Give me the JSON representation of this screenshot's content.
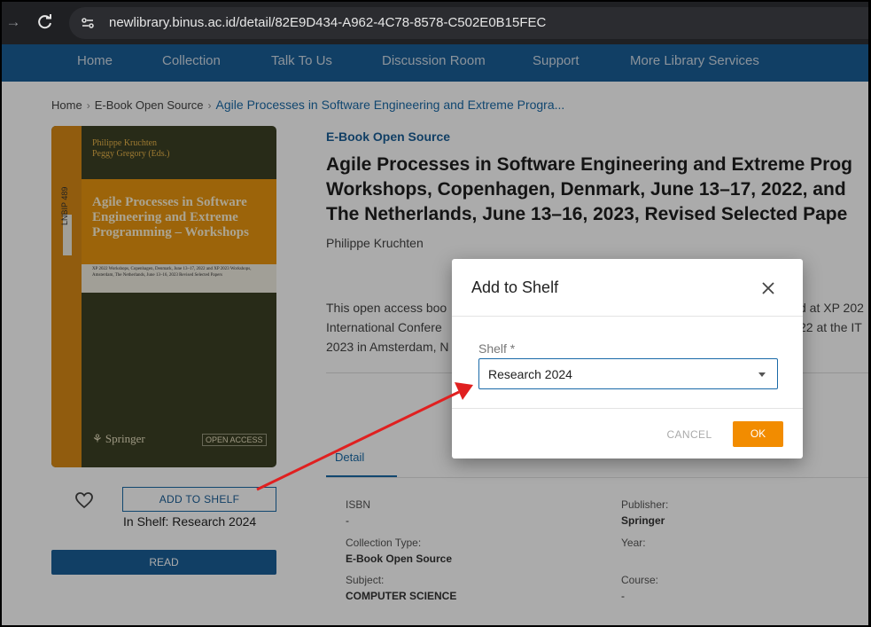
{
  "browser": {
    "url": "newlibrary.binus.ac.id/detail/82E9D434-A962-4C78-8578-C502E0B15FEC"
  },
  "nav": {
    "items": [
      "Home",
      "Collection",
      "Talk To Us",
      "Discussion Room",
      "Support",
      "More Library Services"
    ]
  },
  "breadcrumb": {
    "home": "Home",
    "category": "E-Book Open Source",
    "current": "Agile Processes in Software Engineering and Extreme Progra..."
  },
  "cover": {
    "authors": [
      "Philippe Kruchten",
      "Peggy Gregory (Eds.)"
    ],
    "series": "LNBIP 489",
    "title": "Agile Processes in Software Engineering and Extreme Programming – Workshops",
    "subtitle": "XP 2022 Workshops, Copenhagen, Denmark, June 13–17, 2022 and XP 2023 Workshops, Amsterdam, The Netherlands, June 13–16, 2023 Revised Selected Papers",
    "publisher": "Springer",
    "badge": "OPEN ACCESS"
  },
  "actions": {
    "add_to_shelf": "ADD TO SHELF",
    "in_shelf": "In Shelf: Research 2024",
    "read": "READ"
  },
  "book": {
    "type_label": "E-Book Open Source",
    "title_lines": [
      "Agile Processes in Software Engineering and Extreme Prog",
      "Workshops, Copenhagen, Denmark, June 13–17, 2022, and",
      "The Netherlands, June 13–16, 2023, Revised Selected Pape"
    ],
    "author": "Philippe Kruchten",
    "description_left": [
      "This open access boo",
      "International Confere",
      "2023 in Amsterdam, N"
    ],
    "description_right": [
      "d at XP 202",
      "22 at the IT",
      ""
    ]
  },
  "tabs": {
    "detail": "Detail"
  },
  "meta": {
    "isbn_label": "ISBN",
    "isbn_value": "-",
    "publisher_label": "Publisher:",
    "publisher_value": "Springer",
    "collection_label": "Collection Type:",
    "collection_value": "E-Book Open Source",
    "year_label": "Year:",
    "year_value": "",
    "subject_label": "Subject:",
    "subject_value": "COMPUTER SCIENCE",
    "course_label": "Course:",
    "course_value": "-"
  },
  "dialog": {
    "title": "Add to Shelf",
    "field_label": "Shelf *",
    "selected": "Research 2024",
    "cancel": "CANCEL",
    "ok": "OK"
  },
  "colors": {
    "brand_blue": "#1a5e97",
    "accent_orange": "#f28c00",
    "annotation_red": "#e02020"
  }
}
